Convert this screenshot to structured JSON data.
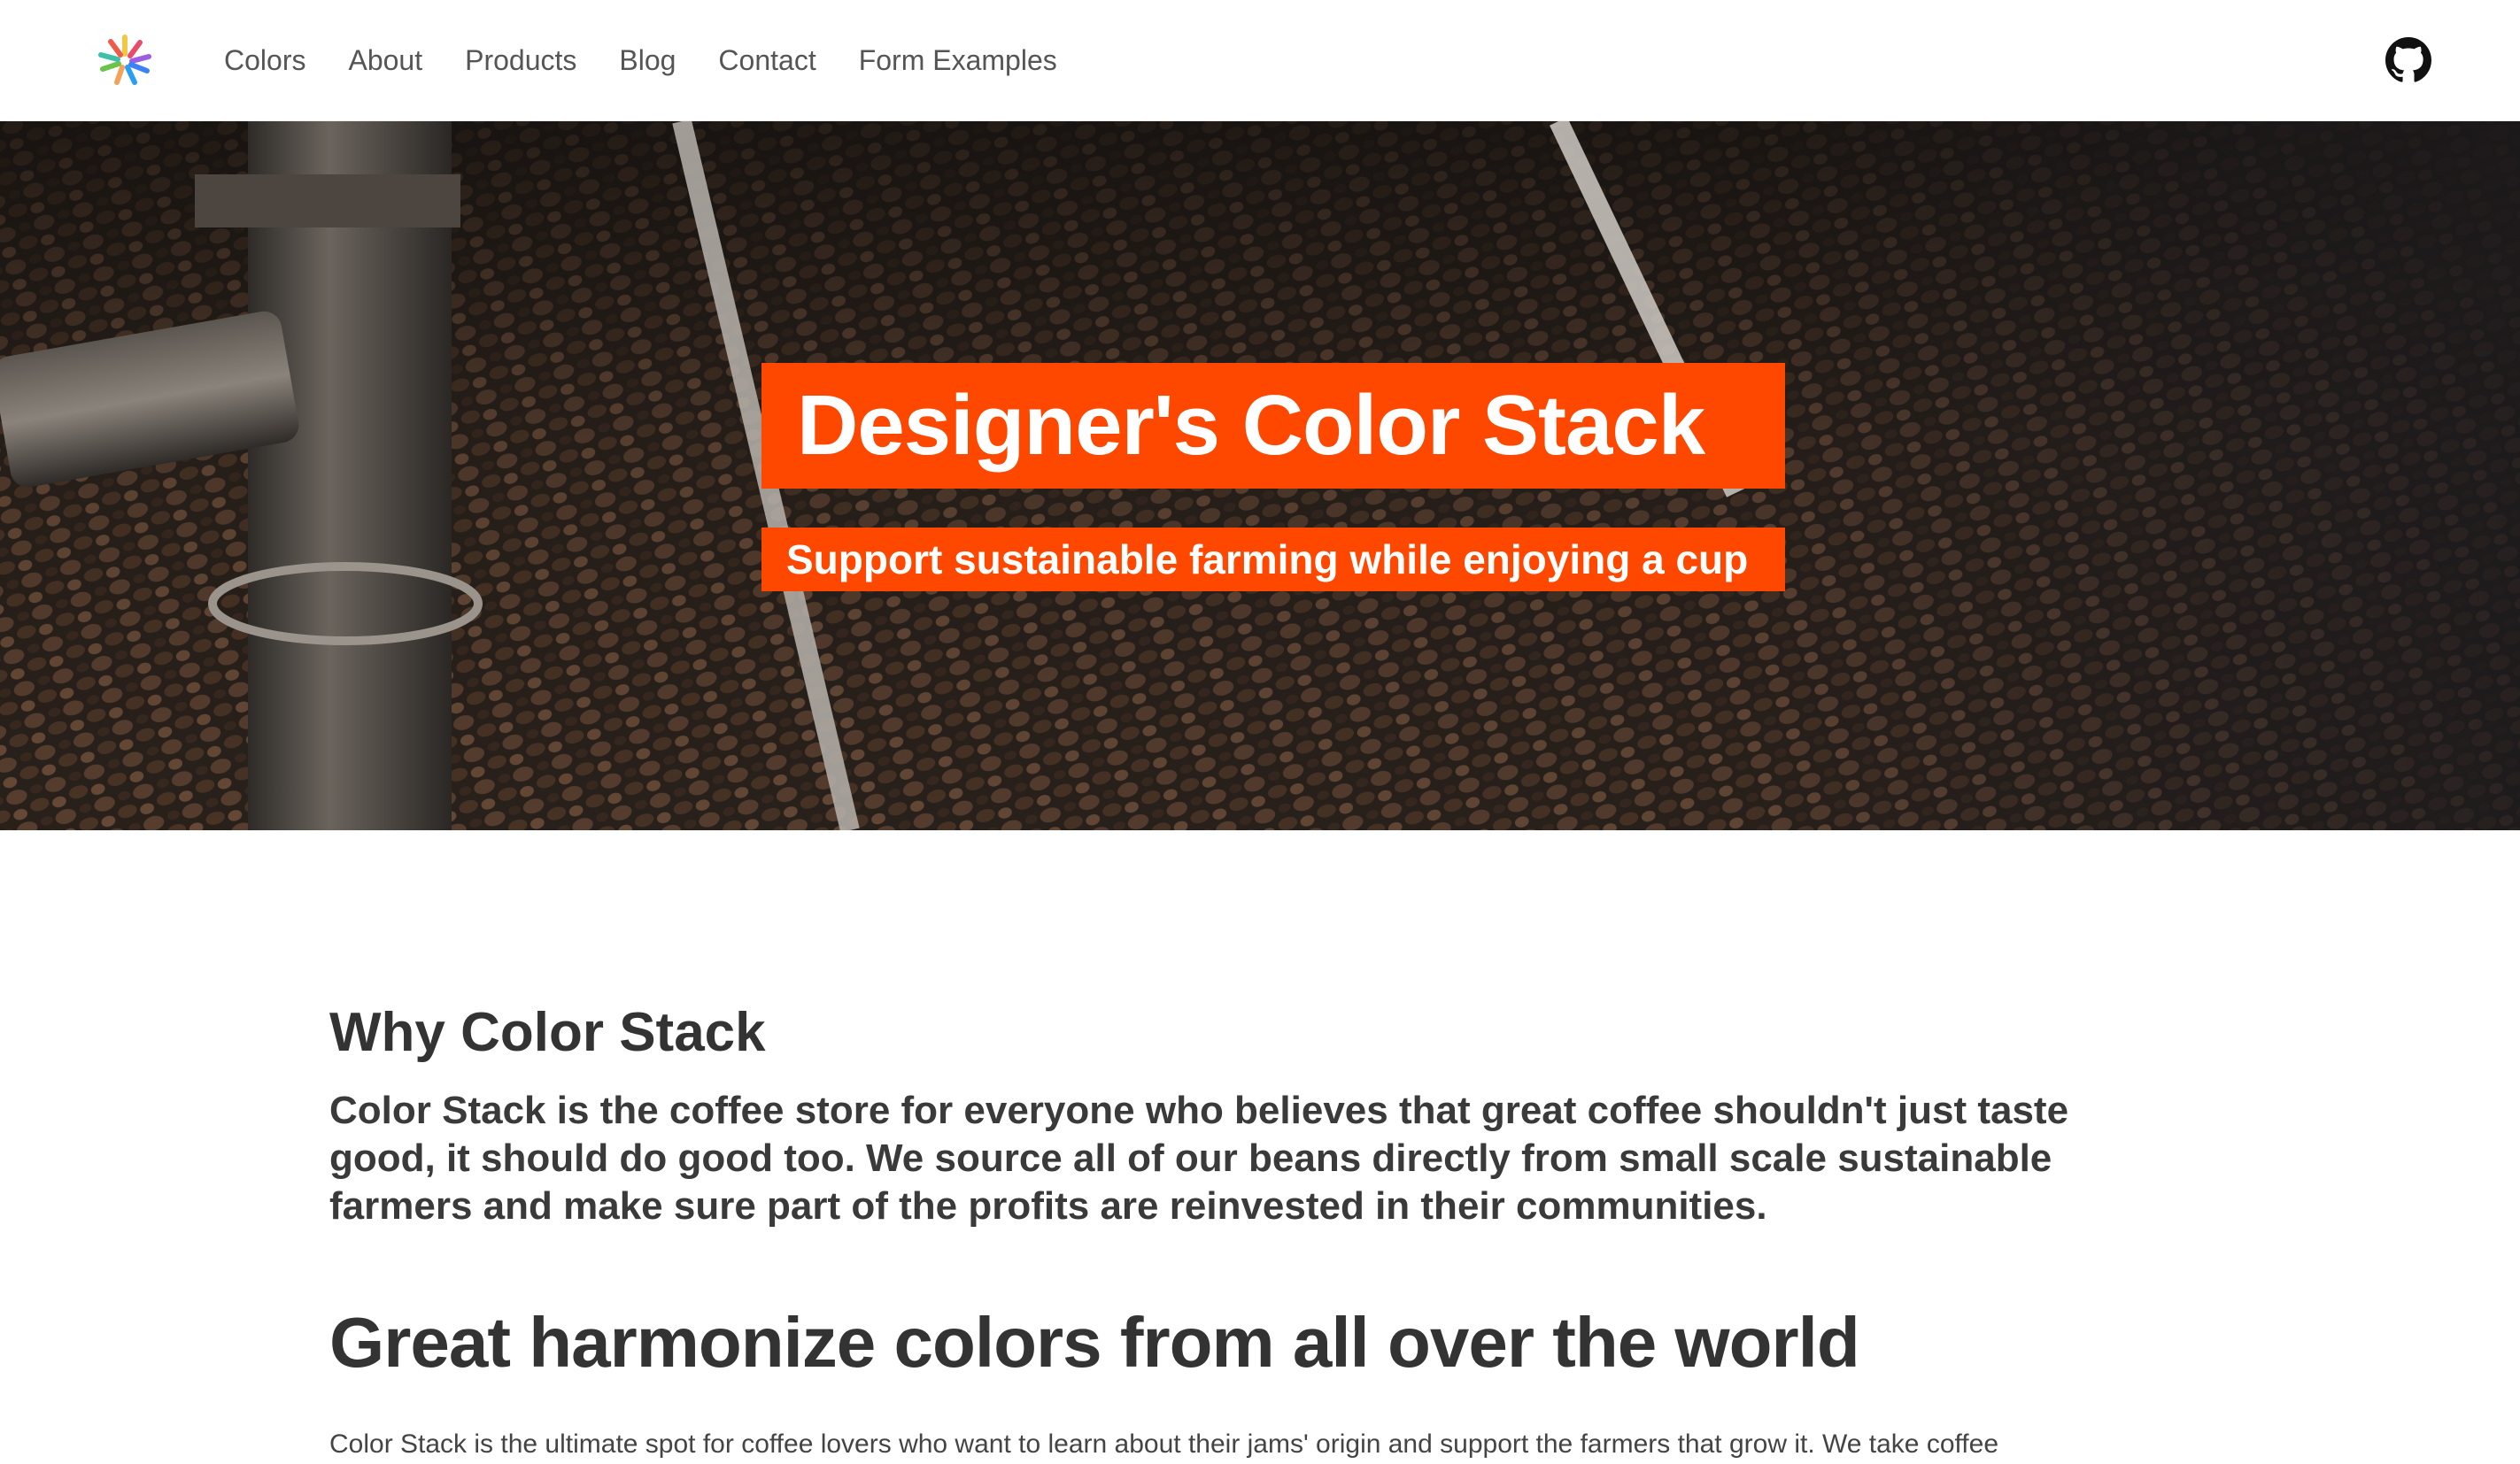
{
  "nav": {
    "logo": "pinwheel-logo",
    "links": [
      {
        "label": "Colors"
      },
      {
        "label": "About"
      },
      {
        "label": "Products"
      },
      {
        "label": "Blog"
      },
      {
        "label": "Contact"
      },
      {
        "label": "Form Examples"
      }
    ],
    "github_icon": "github-icon"
  },
  "hero": {
    "title": "Designer's Color Stack",
    "subtitle": "Support sustainable farming while enjoying a cup",
    "accent_color": "#fe4800",
    "background": "coffee-roaster-photo"
  },
  "content": {
    "why_heading": "Why Color Stack",
    "why_text": "Color Stack is the coffee store for everyone who believes that great coffee shouldn't just taste good, it should do good too. We source all of our beans directly from small scale sustainable farmers and make sure part of the profits are reinvested in their communities.",
    "colors_heading": "Great harmonize colors from all over the world",
    "colors_text": "Color Stack is the ultimate spot for coffee lovers who want to learn about their jams' origin and support the farmers that grow it. We take coffee"
  }
}
